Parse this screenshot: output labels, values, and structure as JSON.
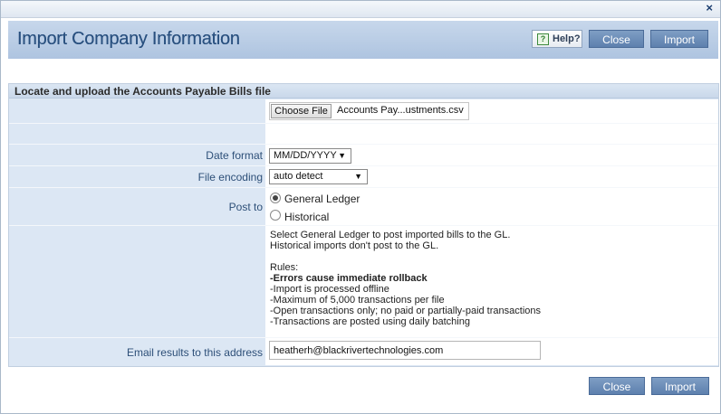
{
  "dialog": {
    "close_glyph": "×",
    "title": "Import Company Information",
    "help_label": "Help?",
    "help_icon": "question-icon",
    "close_label": "Close",
    "import_label": "Import"
  },
  "section": {
    "heading": "Locate and upload the Accounts Payable Bills file"
  },
  "file": {
    "button_label": "Choose File",
    "file_name": "Accounts Pay...ustments.csv"
  },
  "date_format": {
    "label": "Date format",
    "value": "MM/DD/YYYY"
  },
  "file_encoding": {
    "label": "File encoding",
    "value": "auto detect"
  },
  "post_to": {
    "label": "Post to",
    "options": [
      {
        "label": "General Ledger",
        "selected": true
      },
      {
        "label": "Historical",
        "selected": false
      }
    ]
  },
  "info": {
    "lines": [
      "Select General Ledger to post imported bills to the GL.",
      "Historical imports don't post to the GL.",
      "",
      "Rules:",
      "-Errors cause immediate rollback",
      "-Import is processed offline",
      "-Maximum of 5,000 transactions per file",
      "-Open transactions only; no paid or partially-paid transactions",
      "-Transactions are posted using daily batching"
    ]
  },
  "email": {
    "label": "Email results to this address",
    "value": "heatherh@blackrivertechnologies.com"
  },
  "footer": {
    "close_label": "Close",
    "import_label": "Import"
  }
}
